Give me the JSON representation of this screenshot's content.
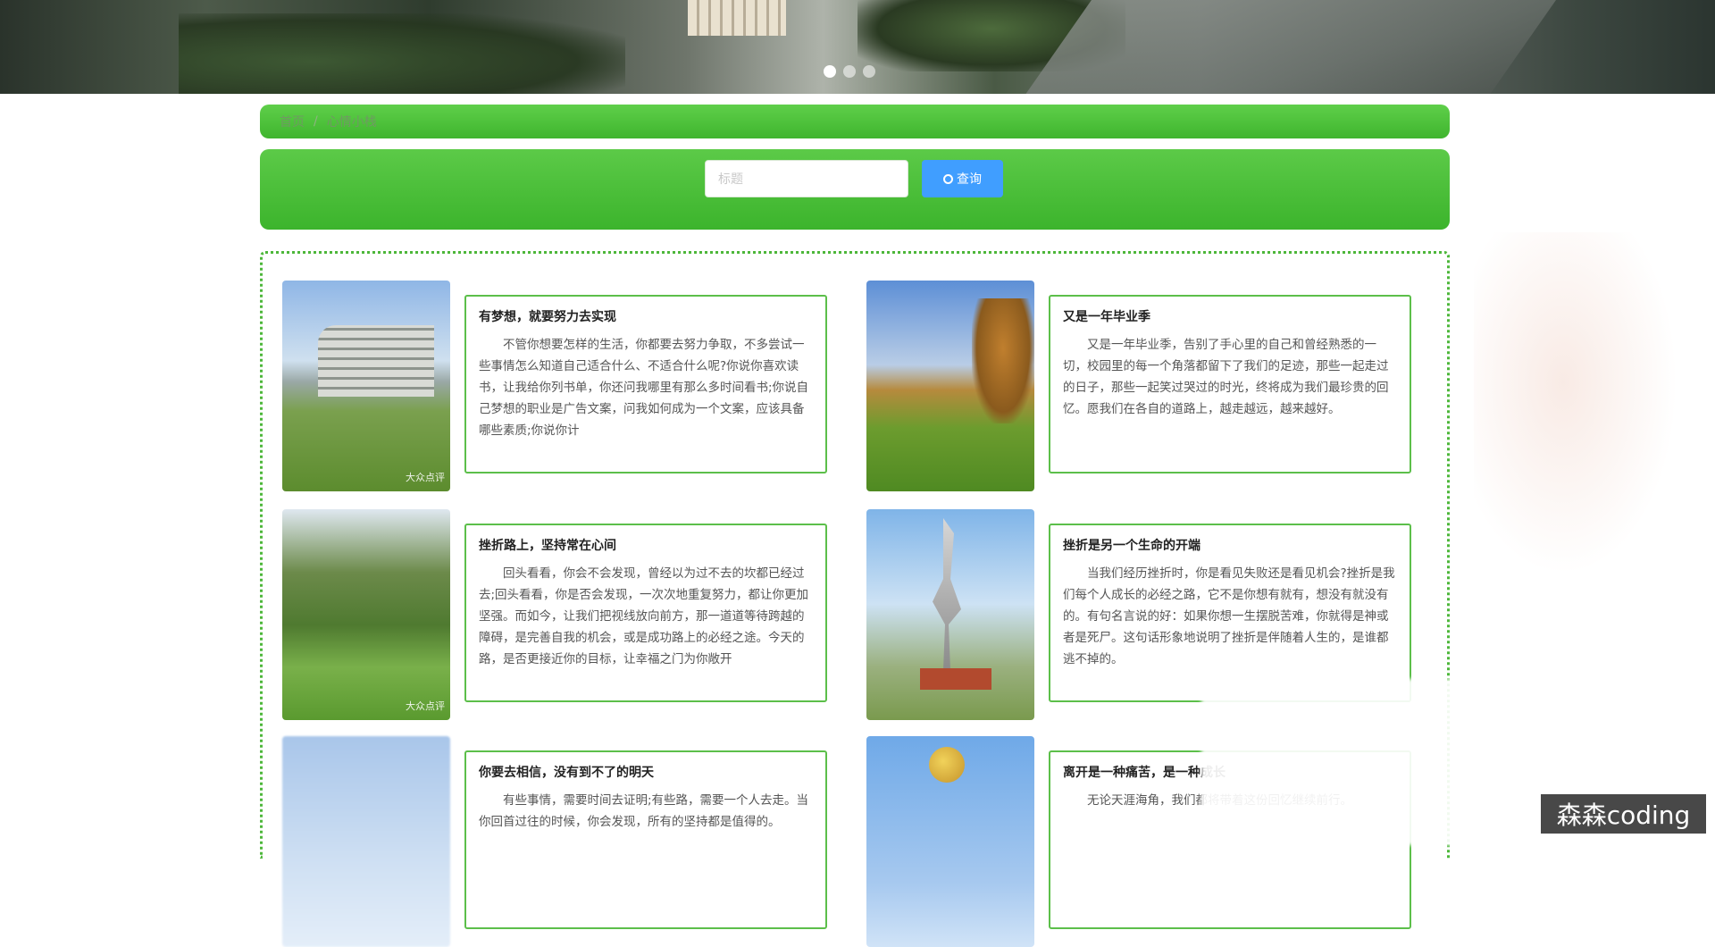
{
  "carousel": {
    "dot_count": 3,
    "active_index": 0
  },
  "breadcrumb": {
    "home": "首页",
    "separator": "/",
    "current": "心情小栈"
  },
  "search": {
    "placeholder": "标题",
    "value": "",
    "button_label": "查询"
  },
  "articles": [
    {
      "title": "有梦想，就要努力去实现",
      "excerpt": "不管你想要怎样的生活，你都要去努力争取，不多尝试一些事情怎么知道自己适合什么、不适合什么呢?你说你喜欢读书，让我给你列书单，你还问我哪里有那么多时间看书;你说自己梦想的职业是广告文案，问我如何成为一个文案，应该具备哪些素质;你说你计",
      "image_watermark": "大众点评"
    },
    {
      "title": "又是一年毕业季",
      "excerpt": "又是一年毕业季，告别了手心里的自己和曾经熟悉的一切，校园里的每一个角落都留下了我们的足迹，那些一起走过的日子，那些一起笑过哭过的时光，终将成为我们最珍贵的回忆。愿我们在各自的道路上，越走越远，越来越好。",
      "image_watermark": ""
    },
    {
      "title": "挫折路上，坚持常在心间",
      "excerpt": "回头看看，你会不会发现，曾经以为过不去的坎都已经过去;回头看看，你是否会发现，一次次地重复努力，都让你更加坚强。而如今，让我们把视线放向前方，那一道道等待跨越的障碍，是完善自我的机会，或是成功路上的必经之途。今天的路，是否更接近你的目标，让幸福之门为你敞开",
      "image_watermark": "大众点评"
    },
    {
      "title": "挫折是另一个生命的开端",
      "excerpt": "当我们经历挫折时，你是看见失败还是看见机会?挫折是我们每个人成长的必经之路，它不是你想有就有，想没有就没有的。有句名言说的好：如果你想一生摆脱苦难，你就得是神或者是死尸。这句话形象地说明了挫折是伴随着人生的，是谁都逃不掉的。",
      "image_watermark": ""
    },
    {
      "title": "你要去相信，没有到不了的明天",
      "excerpt": "有些事情，需要时间去证明;有些路，需要一个人去走。当你回首过往的时候，你会发现，所有的坚持都是值得的。",
      "image_watermark": ""
    },
    {
      "title": "离开是一种痛苦，是一种成长",
      "excerpt": "无论天涯海角，我们都将带着这份回忆继续前行。",
      "image_watermark": ""
    }
  ],
  "corner_badge": "森森coding"
}
